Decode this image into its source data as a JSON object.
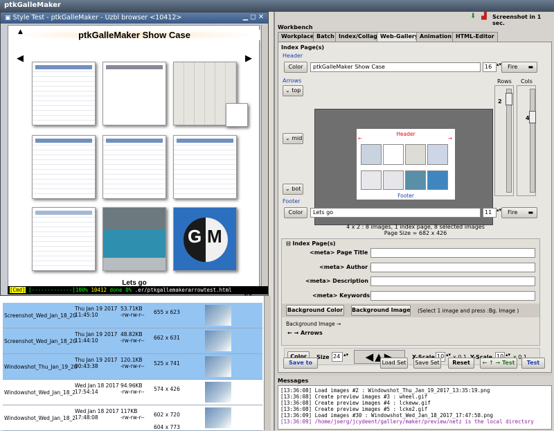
{
  "main_window": {
    "title": "ptkGalleMaker"
  },
  "top_bar": {
    "screenshot_label": "Screenshot in 1 sec."
  },
  "uzbl": {
    "title": "Style Test - ptkGalleMaker - Uzbl browser <10412>",
    "showcase_title": "ptkGalleMaker Show Case",
    "caption": "Lets go",
    "page_counter": "1/1",
    "status_mode": "[Cmd]",
    "status_progress": "[-------------]100%",
    "status_pid": "10412",
    "status_done": "done",
    "status_pct": "0%",
    "status_url": ".er/ptkgallemakerarrowtest.html"
  },
  "file_rows": [
    {
      "name": "Screenshot_Wed_Jan_18_20",
      "date": "Thu Jan 19  2017",
      "time": "11:45:10",
      "size": "53.71KB",
      "perm": "-rw-rw-r--",
      "dims": "655 x 623",
      "selected": true
    },
    {
      "name": "Screenshot_Wed_Jan_18_20",
      "date": "Thu Jan 19  2017",
      "time": "11:44:10",
      "size": "48.82KB",
      "perm": "-rw-rw-r--",
      "dims": "662 x 631",
      "selected": true
    },
    {
      "name": "Windowshot_Thu_Jan_19_20",
      "date": "Thu Jan 19  2017",
      "time": "00:43:38",
      "size": "120.1KB",
      "perm": "-rw-rw-r--",
      "dims": "525 x 741",
      "selected": true
    },
    {
      "name": "Windowshot_Wed_Jan_18_2",
      "date": "Wed Jan 18  2017",
      "time": "17:54:14",
      "size": "94.96KB",
      "perm": "-rw-rw-r--",
      "dims": "574 x 426",
      "selected": false
    },
    {
      "name": "Windowshot_Wed_Jan_18_2",
      "date": "Wed Jan 18  2017",
      "time": "17:48:08",
      "size": "117KB",
      "perm": "-rw-rw-r--",
      "dims": "602 x 720",
      "selected": false
    }
  ],
  "last_row_partial": "604 x 773",
  "workbench": {
    "title": "Workbench",
    "tabs": [
      "Workplace",
      "Batch",
      "Index/Collage",
      "Web-Gallery",
      "Animation",
      "HTML-Editor"
    ],
    "active_tab": "Web-Gallery",
    "index_pages_label": "Index Page(s)",
    "header_label": "Header",
    "color_btn": "Color",
    "header_text": "ptkGalleMaker Show Case",
    "header_size": "16",
    "font_btn": "Fire",
    "arrows_label": "Arrows",
    "arrow_top": "top",
    "arrow_mid": "mid",
    "arrow_bot": "bot",
    "rows_label": "Rows",
    "cols_label": "Cols",
    "rows_value": "2",
    "cols_value": "4",
    "preview_header": "Header",
    "preview_footer": "Footer",
    "footer_label": "Footer",
    "footer_text": "Lets go",
    "footer_size": "11",
    "summary1": "4 x 2 : 8 images, 1 index page, 8 selected images",
    "summary2": "Page Size = 682 x 426",
    "index_section": "⊟ Index Page(s)",
    "meta_title": "<meta> Page Title :",
    "meta_author": "<meta> Author :",
    "meta_description": "<meta> Description :",
    "meta_keywords": "<meta> Keywords :",
    "bg_color_btn": "Background Color",
    "bg_image_btn": "Background Image",
    "bg_hint": "(Select 1 image and press :Bg. Image )",
    "bg_image_label": "Background Image →",
    "arrows_section": "← → Arrows",
    "size_label": "Size",
    "size_value": "24",
    "xscale_label": "X-Scale",
    "xscale_value": "10",
    "xscale_unit": "x 0,1",
    "yscale_label": "Y-Scale",
    "yscale_value": "10",
    "yscale_unit": "x 0,1",
    "save_to": "Save to",
    "load_set": "Load Set",
    "save_set": "Save Set",
    "reset": "Reset",
    "test_arrows": "← ↑ → Test",
    "test": "Test"
  },
  "messages": {
    "title": "Messages",
    "lines": [
      "[13:36:08] Load images #2 : Windowshot_Thu_Jan_19_2017_13:35:19.png",
      "[13:36:08] Create preview images #3 : wheel.gif",
      "[13:36:08] Create preview images #4 : lckeww.gif",
      "[13:36:08] Create preview images #5 : lcke2.gif",
      "[13:36:09] Load images #30 : Windowshot_Wed_Jan_18_2017_17:47:58.png",
      "[13:36:09] /home/joerg/jcydeent/gallery/maker/preview/netz is the local directory"
    ]
  },
  "colors": {
    "accent": "#1a3fb0",
    "selected_row": "#94c4f2",
    "status_bg": "#000000",
    "msg_purple": "#8a1aa0"
  }
}
